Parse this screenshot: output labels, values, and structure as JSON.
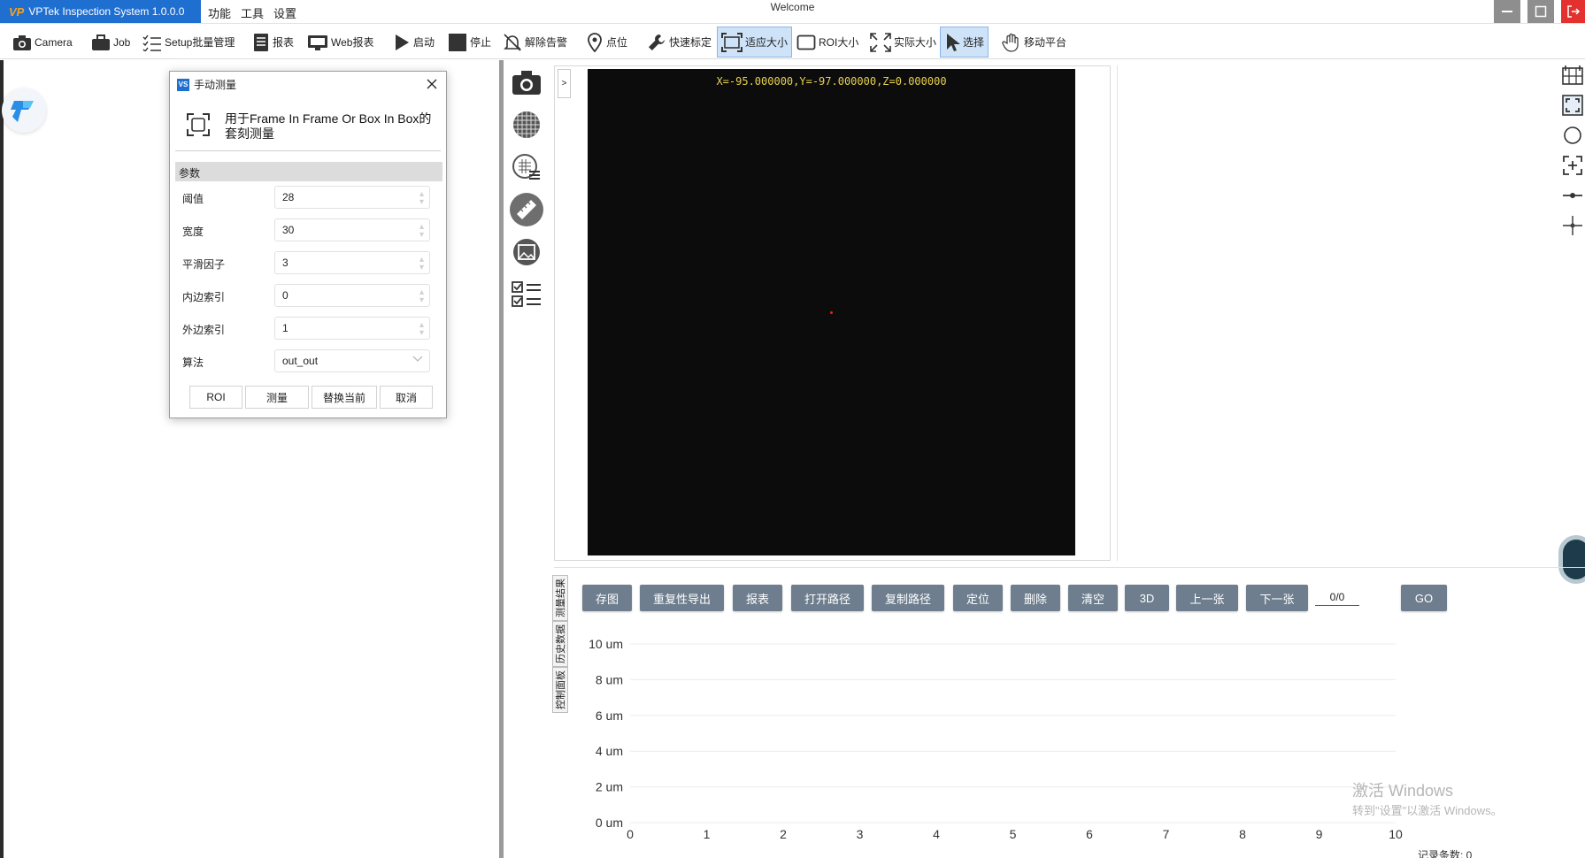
{
  "titlebar": {
    "app_name": "VPTek Inspection System 1.0.0.0",
    "window_title": "Welcome",
    "menus": [
      "功能",
      "工具",
      "设置"
    ]
  },
  "toolbar": {
    "items": [
      {
        "label": "Camera",
        "icon": "camera-icon"
      },
      {
        "label": "Job",
        "icon": "briefcase-icon"
      },
      {
        "label": "Setup批量管理",
        "icon": "checklist-icon"
      },
      {
        "label": "报表",
        "icon": "report-icon"
      },
      {
        "label": "Web报表",
        "icon": "monitor-icon"
      },
      {
        "label": "启动",
        "icon": "play-icon"
      },
      {
        "label": "停止",
        "icon": "stop-icon"
      },
      {
        "label": "解除告警",
        "icon": "bell-off-icon"
      },
      {
        "label": "点位",
        "icon": "location-pin-icon"
      },
      {
        "label": "快速标定",
        "icon": "wrench-icon"
      },
      {
        "label": "适应大小",
        "icon": "fit-screen-icon",
        "active": true
      },
      {
        "label": "ROI大小",
        "icon": "roi-rect-icon"
      },
      {
        "label": "实际大小",
        "icon": "expand-arrows-icon"
      },
      {
        "label": "选择",
        "icon": "cursor-icon",
        "active": true
      },
      {
        "label": "移动平台",
        "icon": "hand-icon"
      }
    ]
  },
  "dialog": {
    "title": "手动测量",
    "description": "用于Frame In Frame Or Box In Box的套刻测量",
    "section": "参数",
    "params": [
      {
        "label": "阈值",
        "value": "28",
        "kind": "spin"
      },
      {
        "label": "宽度",
        "value": "30",
        "kind": "spin"
      },
      {
        "label": "平滑因子",
        "value": "3",
        "kind": "spin"
      },
      {
        "label": "内边索引",
        "value": "0",
        "kind": "spin"
      },
      {
        "label": "外边索引",
        "value": "1",
        "kind": "spin"
      },
      {
        "label": "算法",
        "value": "out_out",
        "kind": "select"
      }
    ],
    "buttons": [
      "ROI",
      "测量",
      "替换当前",
      "取消"
    ]
  },
  "viewer": {
    "coordinates": "X=-95.000000,Y=-97.000000,Z=0.000000",
    "collapse_label": ">"
  },
  "side_tabs": [
    "测量结果",
    "历史数据",
    "控制面板"
  ],
  "actions": [
    "存图",
    "重复性导出",
    "报表",
    "打开路径",
    "复制路径",
    "定位",
    "删除",
    "清空",
    "3D",
    "上一张",
    "下一张"
  ],
  "page_indicator": "0/0",
  "go_label": "GO",
  "watermark": {
    "line1": "激活 Windows",
    "line2": "转到\"设置\"以激活 Windows。"
  },
  "record_count": "记录条数: 0",
  "chart_data": {
    "type": "line",
    "title": "",
    "xlabel": "",
    "ylabel": "",
    "x_ticks": [
      0,
      1,
      2,
      3,
      4,
      5,
      6,
      7,
      8,
      9,
      10
    ],
    "y_ticks": [
      "0 um",
      "2 um",
      "4 um",
      "6 um",
      "8 um",
      "10 um"
    ],
    "xlim": [
      0,
      10
    ],
    "ylim": [
      0,
      10
    ],
    "series": [],
    "grid": true
  },
  "colors": {
    "accent": "#1f6fd1",
    "action_button": "#6e7e8e",
    "close": "#e2312e",
    "coordinate_text": "#e6d04f"
  }
}
